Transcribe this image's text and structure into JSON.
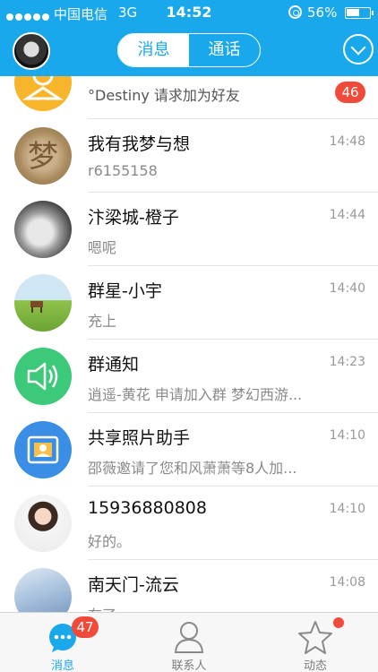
{
  "status_bar": {
    "carrier": "中国电信",
    "network": "3G",
    "time": "14:52",
    "battery": "56%"
  },
  "header": {
    "tabs": [
      {
        "label": "消息",
        "active": true
      },
      {
        "label": "通话",
        "active": false
      }
    ]
  },
  "conversations": [
    {
      "name": "",
      "message": "°Destiny 请求加为好友",
      "time": "",
      "badge": "46",
      "avatar_icon": "friend-request-icon"
    },
    {
      "name": "我有我梦与想",
      "message": "r6155158",
      "time": "14:48",
      "badge": "",
      "avatar_icon": "avatar-photo"
    },
    {
      "name": " 汴梁城-橙子",
      "message": "嗯呢",
      "time": "14:44",
      "badge": "",
      "avatar_icon": "avatar-photo"
    },
    {
      "name": "群星-小宇",
      "message": "充上",
      "time": "14:40",
      "badge": "",
      "avatar_icon": "avatar-photo"
    },
    {
      "name": "群通知",
      "message": "逍遥-黄花 申请加入群 梦幻西游...",
      "time": "14:23",
      "badge": "",
      "avatar_icon": "speaker-icon"
    },
    {
      "name": "共享照片助手",
      "message": "邵薇邀请了您和风萧萧等8人加...",
      "time": "14:10",
      "badge": "",
      "avatar_icon": "photo-share-icon"
    },
    {
      "name": "15936880808",
      "message": "好的。",
      "time": "14:10",
      "badge": "",
      "avatar_icon": "avatar-photo"
    },
    {
      "name": "南天门-流云",
      "message": "在了",
      "time": "14:08",
      "badge": "",
      "avatar_icon": "avatar-photo"
    }
  ],
  "tabbar": {
    "items": [
      {
        "label": "消息",
        "icon": "chat-bubble-icon",
        "badge": "47",
        "active": true
      },
      {
        "label": "联系人",
        "icon": "contacts-icon",
        "badge": "",
        "active": false
      },
      {
        "label": "动态",
        "icon": "star-icon",
        "badge": "",
        "active": false
      }
    ]
  },
  "colors": {
    "accent": "#19a8ec",
    "badge": "#f24a3a",
    "notice_green": "#3cc97a",
    "photo_blue": "#3a8ee6",
    "request_orange": "#f7b52c"
  }
}
